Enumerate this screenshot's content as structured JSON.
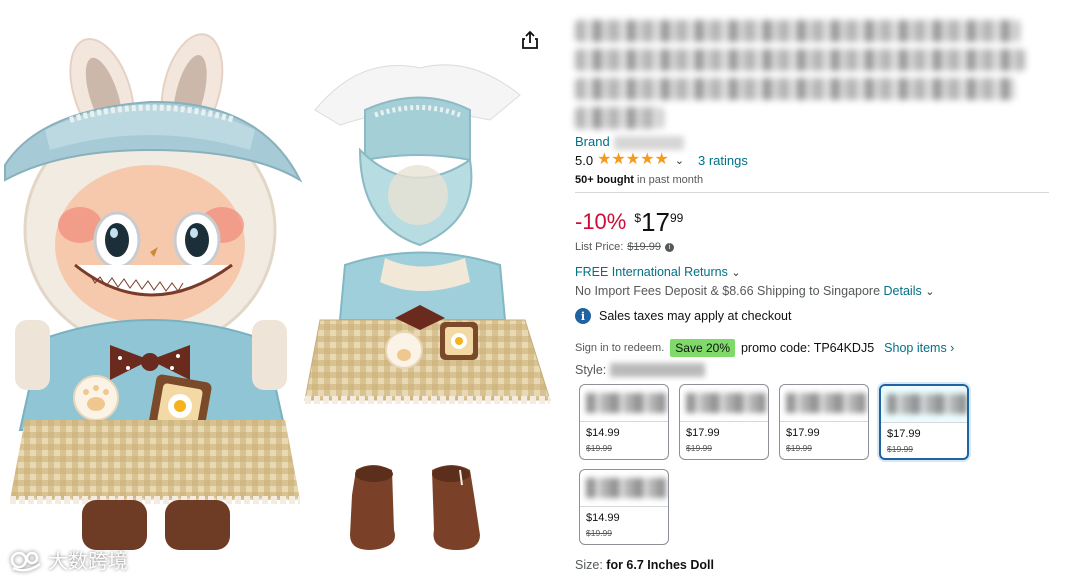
{
  "gallery": {
    "watermark": "大数跨境"
  },
  "product": {
    "brand_label": "Brand",
    "rating_value": "5.0",
    "rating_stars": 5,
    "ratings_count": "3 ratings",
    "bought_strong": "50+ bought",
    "bought_rest": " in past month"
  },
  "price": {
    "discount": "-10%",
    "currency": "$",
    "whole": "17",
    "fraction": "99",
    "list_price_label": "List Price:",
    "list_price": "$19.99"
  },
  "delivery": {
    "returns": "FREE International Returns",
    "shipping": "No Import Fees Deposit & $8.66 Shipping to Singapore",
    "shipping_link": "Details",
    "tax_note": "Sales taxes may apply at checkout"
  },
  "promo": {
    "signin": "Sign in to redeem.",
    "save": "Save 20%",
    "code_text": "promo code: TP64KDJ5",
    "shop_link": "Shop items ›"
  },
  "style": {
    "label": "Style:",
    "options": [
      {
        "price": "$14.99",
        "old_price": "$19.99",
        "selected": false
      },
      {
        "price": "$17.99",
        "old_price": "$19.99",
        "selected": false
      },
      {
        "price": "$17.99",
        "old_price": "$19.99",
        "selected": false
      },
      {
        "price": "$17.99",
        "old_price": "$19.99",
        "selected": true
      },
      {
        "price": "$14.99",
        "old_price": "$19.99",
        "selected": false
      }
    ]
  },
  "size": {
    "label": "Size:",
    "value": "for 6.7 Inches Doll"
  },
  "colors": {
    "link": "#007185",
    "discount": "#cc0c39",
    "star": "#f79a1c",
    "save_badge": "#7fda69",
    "selected_border": "#2162a1"
  }
}
